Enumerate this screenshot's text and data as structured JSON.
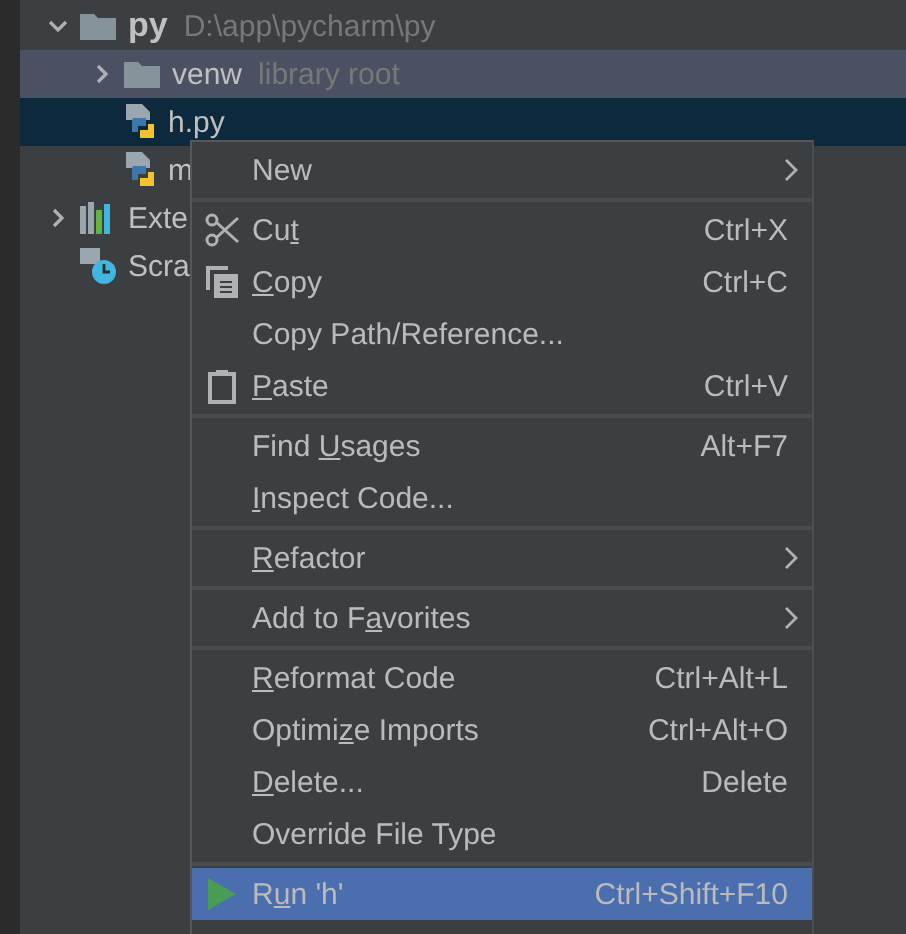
{
  "tree": [
    {
      "label": "py",
      "hint": "D:\\app\\pycharm\\py",
      "kind": "folder",
      "expanded": true,
      "selected": false,
      "hovered": false,
      "children": [
        {
          "label": "venw",
          "hint": "library root",
          "kind": "folder",
          "expanded": false,
          "selected": false,
          "hovered": true
        },
        {
          "label": "h.py",
          "kind": "python",
          "selected": true,
          "hovered": false
        },
        {
          "label": "m",
          "kind": "python",
          "selected": false,
          "hovered": false
        }
      ]
    },
    {
      "label": "Exte",
      "kind": "libraries",
      "expanded": false,
      "selected": false,
      "hovered": false
    },
    {
      "label": "Scra",
      "kind": "scratches",
      "selected": false,
      "hovered": false
    }
  ],
  "context_menu": {
    "groups": [
      {
        "items": [
          {
            "label": [
              {
                "text": "New"
              }
            ],
            "submenu": true,
            "selected": false
          }
        ]
      },
      {
        "items": [
          {
            "kind": "cut",
            "label": [
              {
                "text": "Cu"
              },
              {
                "text": "t",
                "underlined": true
              }
            ],
            "shortcut": "Ctrl+X",
            "selected": false
          },
          {
            "kind": "copy",
            "label": [
              {
                "text": "C",
                "underlined": true
              },
              {
                "text": "opy"
              }
            ],
            "shortcut": "Ctrl+C",
            "selected": false
          },
          {
            "label": [
              {
                "text": "Copy Path/Reference..."
              }
            ],
            "selected": false
          },
          {
            "kind": "paste",
            "label": [
              {
                "text": "P",
                "underlined": true
              },
              {
                "text": "aste"
              }
            ],
            "shortcut": "Ctrl+V",
            "selected": false
          }
        ]
      },
      {
        "items": [
          {
            "label": [
              {
                "text": "Find "
              },
              {
                "text": "U",
                "underlined": true
              },
              {
                "text": "sages"
              }
            ],
            "shortcut": "Alt+F7",
            "selected": false
          },
          {
            "label": [
              {
                "text": "I",
                "underlined": true
              },
              {
                "text": "nspect Code..."
              }
            ],
            "selected": false
          }
        ]
      },
      {
        "items": [
          {
            "label": [
              {
                "text": "R",
                "underlined": true
              },
              {
                "text": "efactor"
              }
            ],
            "submenu": true,
            "selected": false
          }
        ]
      },
      {
        "items": [
          {
            "label": [
              {
                "text": "Add to F"
              },
              {
                "text": "a",
                "underlined": true
              },
              {
                "text": "vorites"
              }
            ],
            "submenu": true,
            "selected": false
          }
        ]
      },
      {
        "items": [
          {
            "label": [
              {
                "text": "R",
                "underlined": true
              },
              {
                "text": "eformat Code"
              }
            ],
            "shortcut": "Ctrl+Alt+L",
            "selected": false
          },
          {
            "label": [
              {
                "text": "Optimi"
              },
              {
                "text": "z",
                "underlined": true
              },
              {
                "text": "e Imports"
              }
            ],
            "shortcut": "Ctrl+Alt+O",
            "selected": false
          },
          {
            "label": [
              {
                "text": "D",
                "underlined": true
              },
              {
                "text": "elete..."
              }
            ],
            "shortcut": "Delete",
            "selected": false
          },
          {
            "label": [
              {
                "text": "Override File Type"
              }
            ],
            "selected": false
          }
        ]
      },
      {
        "items": [
          {
            "kind": "run",
            "label": [
              {
                "text": "R"
              },
              {
                "text": "u",
                "underlined": true
              },
              {
                "text": "n 'h'"
              }
            ],
            "shortcut": "Ctrl+Shift+F10",
            "selected": true
          }
        ]
      }
    ]
  }
}
